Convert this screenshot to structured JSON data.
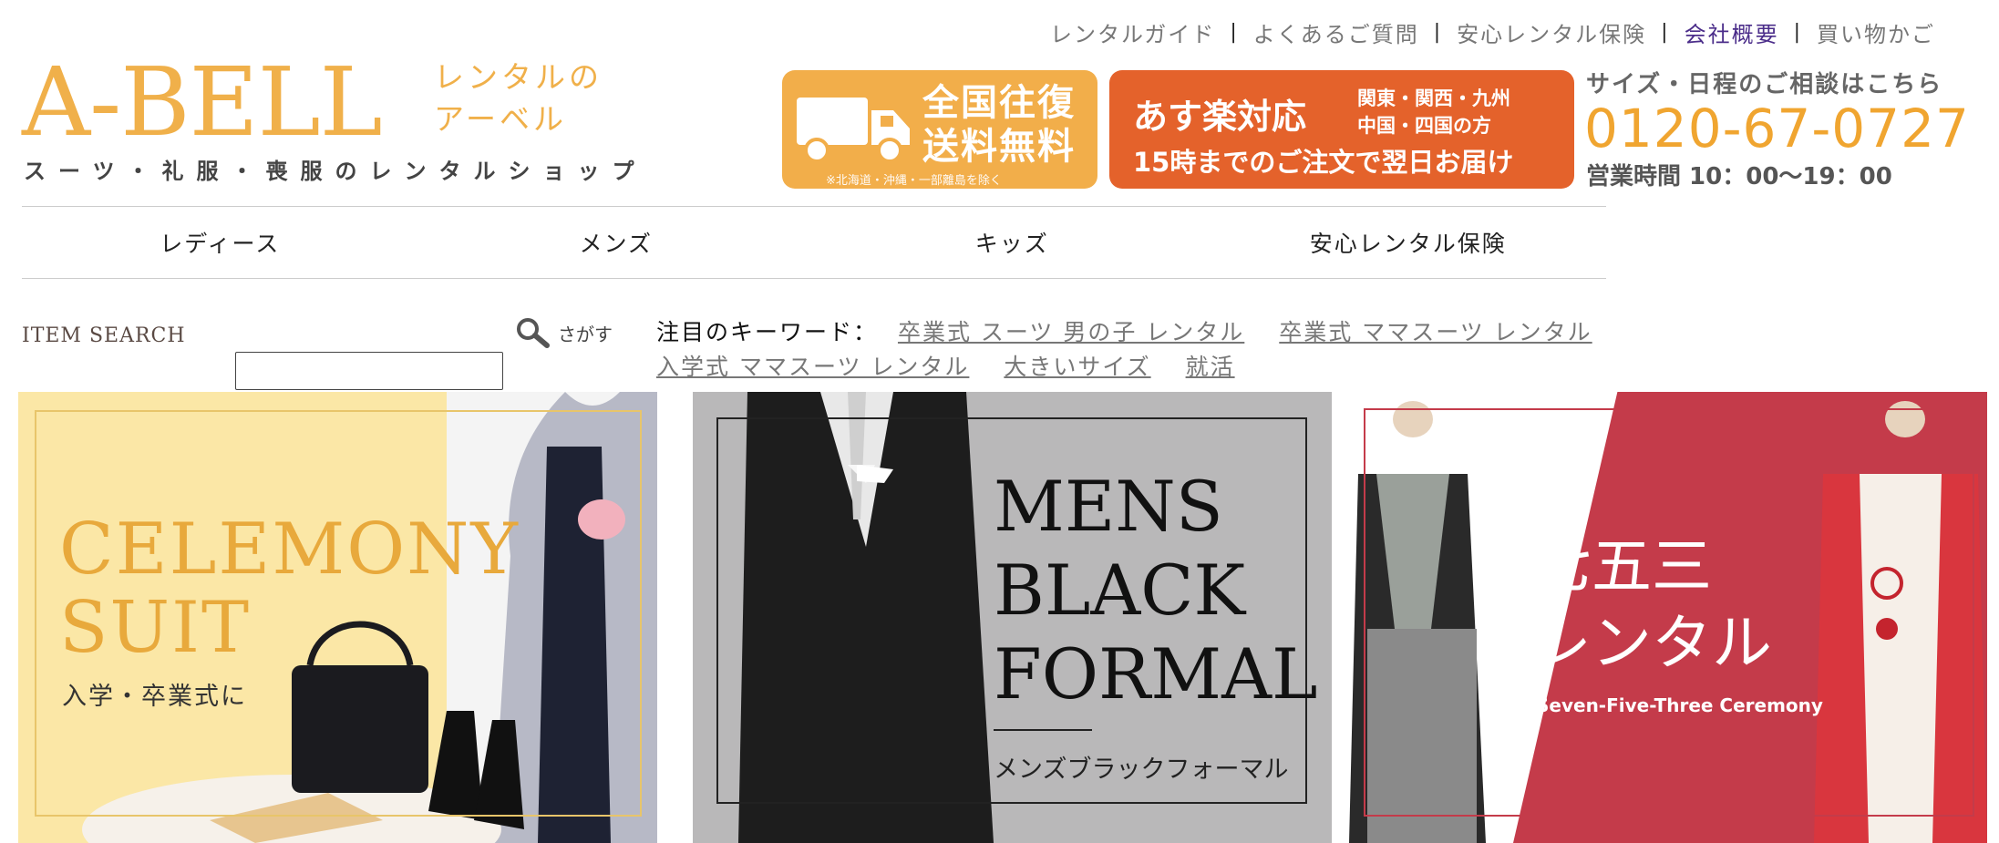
{
  "util_links": [
    {
      "label": "レンタルガイド"
    },
    {
      "label": "よくあるご質問"
    },
    {
      "label": "安心レンタル保険"
    },
    {
      "label": "会社概要"
    },
    {
      "label": "買い物かご"
    }
  ],
  "util_separator": "|",
  "logo": {
    "main": "A-BELL",
    "sub_line1": "レンタルの",
    "sub_line2": "アーベル",
    "tagline": "スーツ・礼服・喪服のレンタルショップ"
  },
  "shipping_banner": {
    "line1": "全国往復",
    "line2": "送料無料",
    "note": "※北海道・沖縄・一部離島を除く"
  },
  "ontime_banner": {
    "main": "あす楽対応",
    "regions_line1": "関東・関西・九州",
    "regions_line2": "中国・四国の方",
    "detail": "15時までのご注文で翌日お届け"
  },
  "contact": {
    "heading": "サイズ・日程のご相談はこちら",
    "phone": "0120-67-0727",
    "hours": "営業時間 10：00〜19：00"
  },
  "nav": [
    {
      "label": "レディース"
    },
    {
      "label": "メンズ"
    },
    {
      "label": "キッズ"
    },
    {
      "label": "安心レンタル保険"
    }
  ],
  "search": {
    "label": "ITEM SEARCH",
    "button_label": "さがす",
    "value": ""
  },
  "keywords": {
    "label": "注目のキーワード：",
    "items": [
      "卒業式 スーツ 男の子 レンタル",
      "卒業式 ママスーツ レンタル",
      "入学式 ママスーツ レンタル",
      "大きいサイズ",
      "就活"
    ]
  },
  "tiles": {
    "ceremony": {
      "title_line1": "CELEMONY",
      "title_line2": "SUIT",
      "subtitle": "入学・卒業式に"
    },
    "mens": {
      "title_line1": "MENS",
      "title_line2": "BLACK",
      "title_line3": "FORMAL",
      "subtitle": "メンズブラックフォーマル"
    },
    "shichigosan": {
      "title_line1": "七五三",
      "title_line2": "レンタル",
      "subtitle": "Seven-Five-Three Ceremony"
    }
  },
  "colors": {
    "brand_orange": "#f0b04a",
    "banner_orange_dark": "#e4622b",
    "active_link": "#4b2d8a",
    "kids_red": "#c43b4a"
  }
}
